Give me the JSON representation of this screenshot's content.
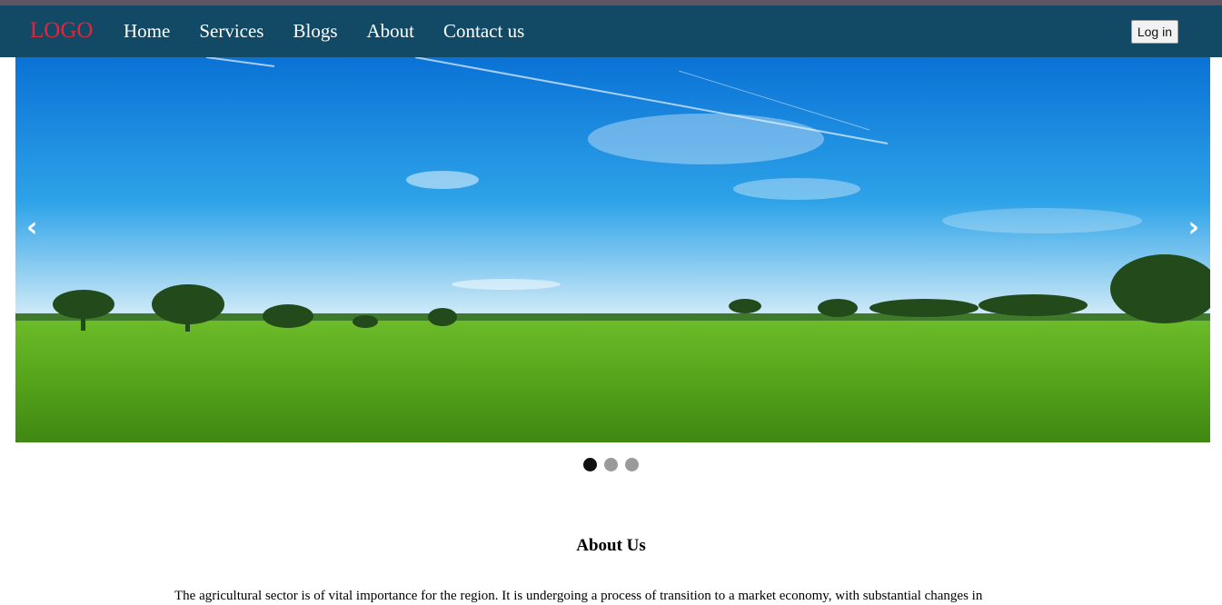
{
  "navbar": {
    "logo": "LOGO",
    "links": [
      "Home",
      "Services",
      "Blogs",
      "About",
      "Contact us"
    ],
    "login_label": "Log in"
  },
  "slider": {
    "prev_label": "‹",
    "next_label": "›",
    "slide_count": 3,
    "active_index": 0
  },
  "about": {
    "title": "About Us",
    "text": "The agricultural sector is of vital importance for the region. It is undergoing a process of transition to a market economy, with substantial changes in"
  },
  "colors": {
    "navbar": "#124a66",
    "logo": "#e5243a",
    "dot_active": "#111111",
    "dot_inactive": "#9a9a9a"
  }
}
